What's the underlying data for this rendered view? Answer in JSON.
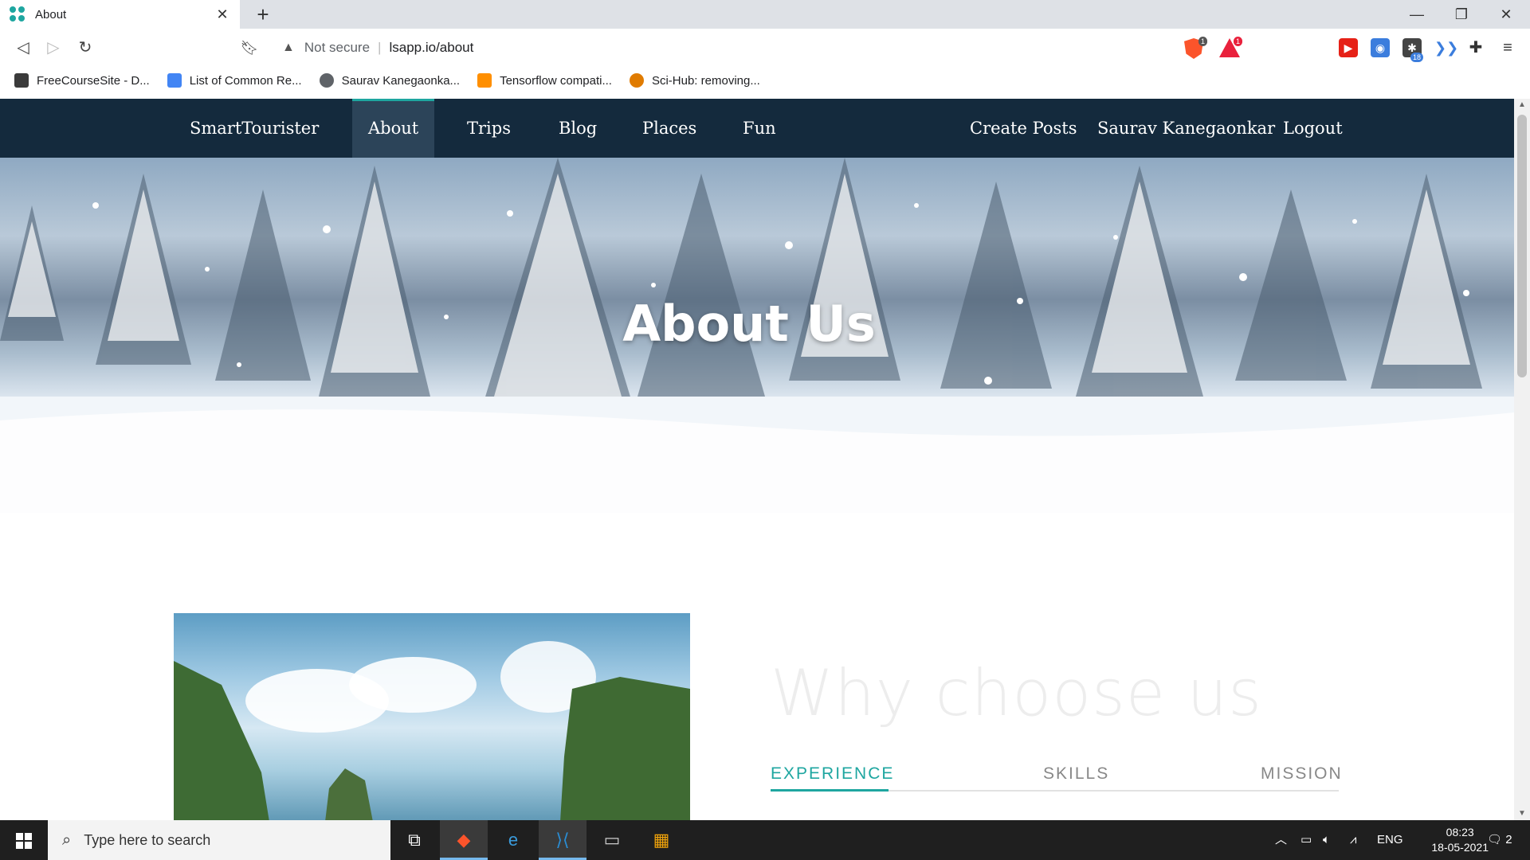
{
  "browser": {
    "tab_title": "About",
    "new_tab": "+",
    "address": {
      "security_label": "Not secure",
      "separator": "|",
      "url": "lsapp.io/about"
    },
    "brave_shield_count": "1",
    "brave_rewards_count": "1",
    "extension_badge": "18",
    "bookmarks": [
      {
        "label": "FreeCourseSite - D...",
        "icon": "freecoursesite-icon",
        "color": "#3b3b3b"
      },
      {
        "label": "List of Common Re...",
        "icon": "docs-icon",
        "color": "#4285f4"
      },
      {
        "label": "Saurav Kanegaonka...",
        "icon": "globe-icon",
        "color": "#5f6368"
      },
      {
        "label": "Tensorflow compati...",
        "icon": "tensorflow-icon",
        "color": "#ff8f00"
      },
      {
        "label": "Sci-Hub: removing...",
        "icon": "scihub-icon",
        "color": "#e07b00"
      }
    ]
  },
  "site": {
    "brand": "SmartTourister",
    "nav_left": [
      {
        "label": "About",
        "active": true
      },
      {
        "label": "Trips",
        "active": false
      },
      {
        "label": "Blog",
        "active": false
      },
      {
        "label": "Places",
        "active": false
      },
      {
        "label": "Fun",
        "active": false
      }
    ],
    "nav_right": [
      {
        "label": "Create Posts"
      },
      {
        "label": "Saurav Kanegaonkar"
      },
      {
        "label": "Logout"
      }
    ],
    "hero_title": "About Us",
    "section_title": "Why choose us",
    "section_tabs": [
      {
        "label": "EXPERIENCE",
        "active": true
      },
      {
        "label": "SKILLS",
        "active": false
      },
      {
        "label": "MISSION",
        "active": false
      }
    ],
    "accent_color": "#1ea6a0",
    "nav_bg": "#142a3d"
  },
  "taskbar": {
    "search_placeholder": "Type here to search",
    "language": "ENG",
    "time": "08:23",
    "date": "18-05-2021",
    "notification_count": "2"
  }
}
